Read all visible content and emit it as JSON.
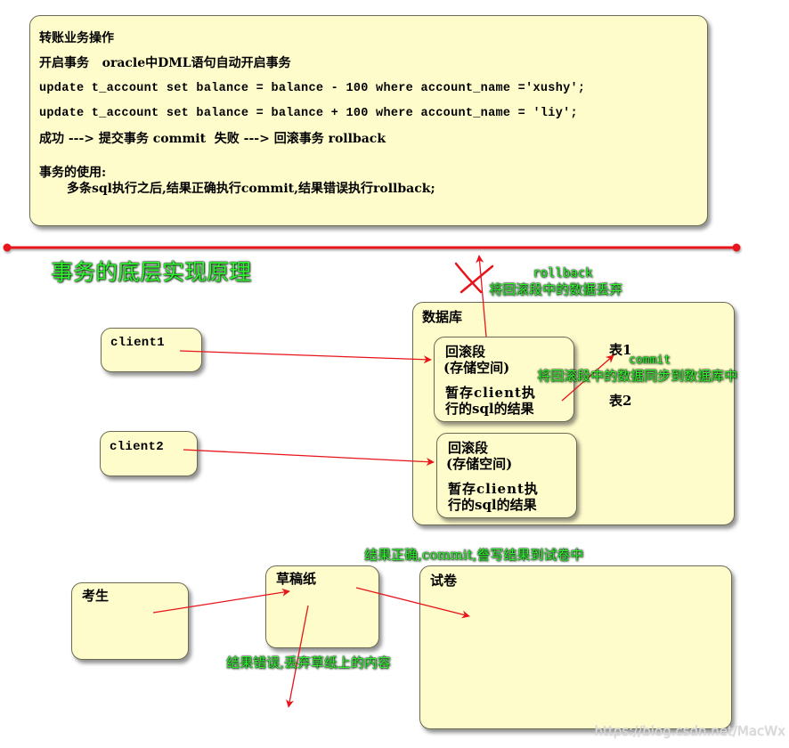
{
  "top_note": {
    "title": "转账业务操作",
    "line_begin": "开启事务   oracle中DML语句自动开启事务",
    "sql_debit": "update t_account set balance = balance - 100 where account_name ='xushy';",
    "sql_credit": "update t_account set balance = balance + 100 where account_name = 'liy';",
    "outcome": "成功 ---> 提交事务 commit  失败 ---> 回滚事务 rollback",
    "usage_heading": "事务的使用:",
    "usage_detail": "多条sql执行之后,结果正确执行commit,结果错误执行rollback;"
  },
  "section_title": "事务的底层实现原理",
  "clients": [
    {
      "label": "client1"
    },
    {
      "label": "client2"
    }
  ],
  "database": {
    "label": "数据库",
    "rollback_segments": [
      {
        "title": "回滚段",
        "subtitle": "(存储空间)",
        "desc_line1": "暂存client执",
        "desc_line2": "行的sql的结果"
      },
      {
        "title": "回滚段",
        "subtitle": "(存储空间)",
        "desc_line1": "暂存client执",
        "desc_line2": "行的sql的结果"
      }
    ],
    "tables": [
      "表1",
      "表2"
    ]
  },
  "annotations": {
    "rollback_keyword": "rollback",
    "rollback_desc": "将回滚段中的数据丢弃",
    "commit_keyword": "commit",
    "commit_desc": "将回滚段中的数据同步到数据库中",
    "exam_correct": "结果正确,commit,誊写结果到试卷中",
    "exam_wrong": "结果错误,丢弃草纸上的内容"
  },
  "analogy": {
    "student": "考生",
    "scratch_paper": "草稿纸",
    "exam_paper": "试卷"
  },
  "watermark": "https://blog.csdn.net/MacWx",
  "colors": {
    "box_fill": "#fffccb",
    "arrow_red": "#e8141b",
    "annotation_green": "#2ef52e"
  }
}
